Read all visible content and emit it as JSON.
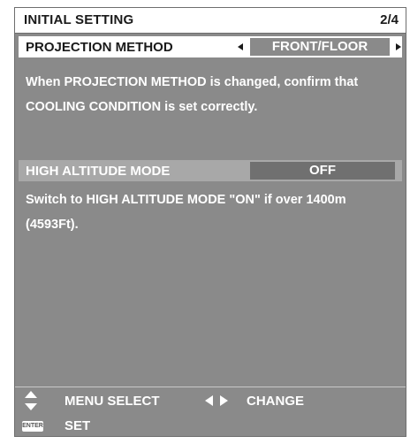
{
  "header": {
    "title": "INITIAL SETTING",
    "page_indicator": "2/4"
  },
  "projection_method": {
    "label": "PROJECTION METHOD",
    "value": "FRONT/FLOOR",
    "note_line1": "When PROJECTION METHOD is changed, confirm that",
    "note_line2": "COOLING CONDITION is set correctly."
  },
  "high_altitude": {
    "label": "HIGH ALTITUDE MODE",
    "value": "OFF",
    "note_line1": "Switch to HIGH ALTITUDE MODE \"ON\" if over 1400m",
    "note_line2": "(4593Ft)."
  },
  "footer": {
    "menu_select": "MENU SELECT",
    "change": "CHANGE",
    "enter_key": "ENTER",
    "set": "SET"
  },
  "icons": {
    "updown": "updown-arrows-icon",
    "leftright": "leftright-arrows-icon",
    "enter": "enter-key-icon"
  }
}
